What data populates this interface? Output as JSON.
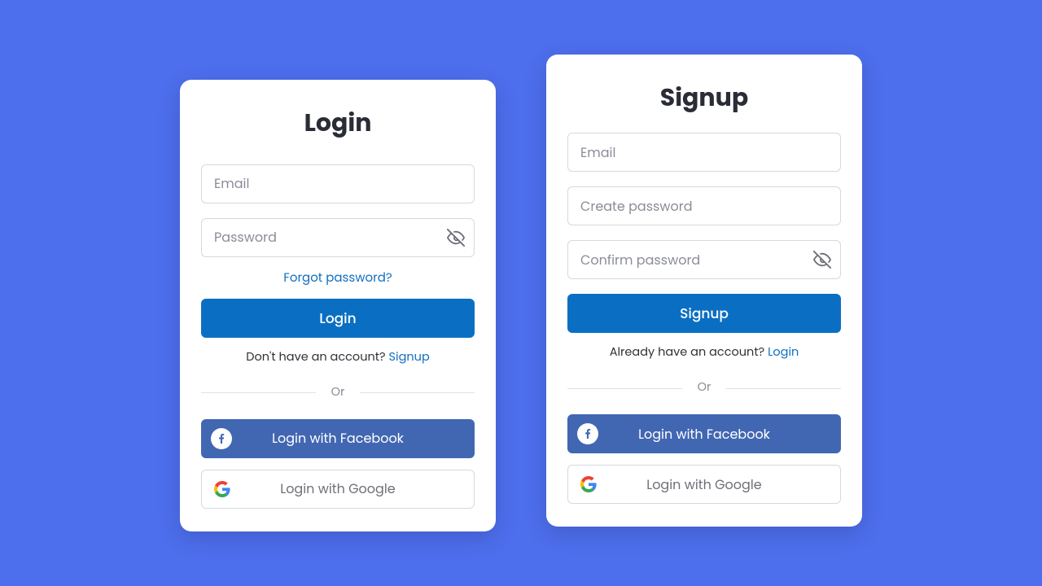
{
  "login": {
    "title": "Login",
    "email_placeholder": "Email",
    "password_placeholder": "Password",
    "forgot": "Forgot password?",
    "submit": "Login",
    "switch_prompt": "Don't have an account? ",
    "switch_link": "Signup",
    "divider": "Or",
    "facebook_label": "Login with Facebook",
    "google_label": "Login with Google"
  },
  "signup": {
    "title": "Signup",
    "email_placeholder": "Email",
    "create_password_placeholder": "Create password",
    "confirm_password_placeholder": "Confirm password",
    "submit": "Signup",
    "switch_prompt": "Already have an account? ",
    "switch_link": "Login",
    "divider": "Or",
    "facebook_label": "Login with Facebook",
    "google_label": "Login with Google"
  },
  "colors": {
    "background": "#4d6eed",
    "primary": "#0a6fc2",
    "link": "#126fbf",
    "facebook": "#4267b2"
  }
}
